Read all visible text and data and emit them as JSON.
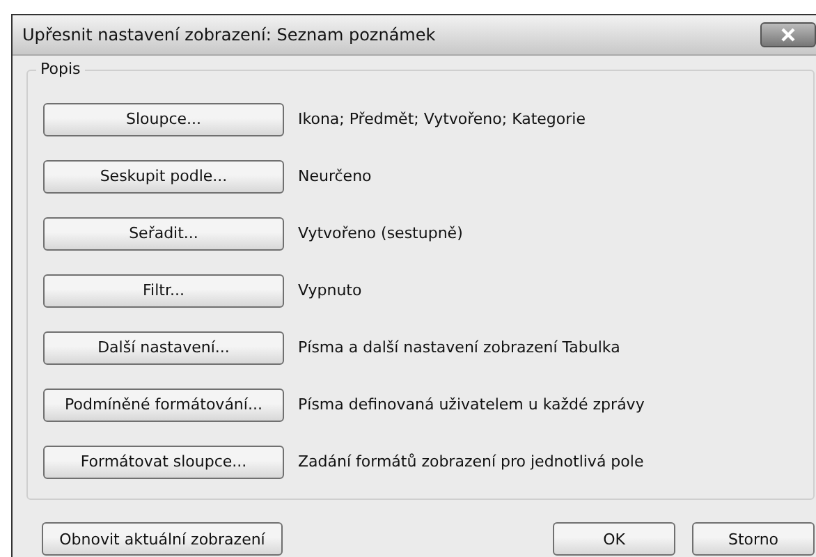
{
  "window": {
    "title": "Upřesnit nastavení zobrazení: Seznam poznámek"
  },
  "group": {
    "label": "Popis",
    "rows": [
      {
        "button": "Sloupce...",
        "value": "Ikona; Předmět; Vytvořeno; Kategorie"
      },
      {
        "button": "Seskupit podle...",
        "value": "Neurčeno"
      },
      {
        "button": "Seřadit...",
        "value": "Vytvořeno (sestupně)"
      },
      {
        "button": "Filtr...",
        "value": "Vypnuto"
      },
      {
        "button": "Další nastavení...",
        "value": "Písma a další nastavení zobrazení Tabulka"
      },
      {
        "button": "Podmíněné formátování...",
        "value": "Písma definovaná uživatelem u každé zprávy"
      },
      {
        "button": "Formátovat sloupce...",
        "value": "Zadání formátů zobrazení pro jednotlivá pole"
      }
    ]
  },
  "buttons": {
    "reset": "Obnovit aktuální zobrazení",
    "ok": "OK",
    "cancel": "Storno"
  }
}
